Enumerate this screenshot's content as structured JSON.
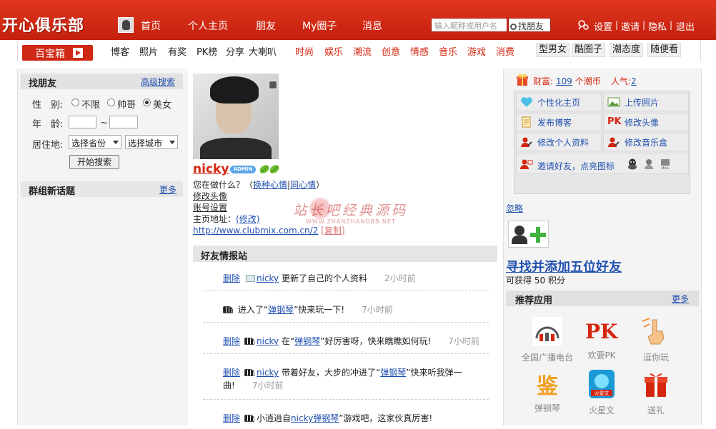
{
  "header": {
    "logo": "开心俱乐部",
    "nav": [
      "首页",
      "个人主页",
      "朋友",
      "My圈子",
      "消息"
    ],
    "search_placeholder": "输入昵称或用户名",
    "find_friend_btn": "找朋友",
    "links": [
      "设置",
      "邀请",
      "隐私",
      "退出"
    ]
  },
  "subnav": {
    "baobox": "百宝箱",
    "group1": [
      "博客",
      "照片",
      "有奖",
      "PK榜",
      "分享",
      "大喇叭"
    ],
    "group2": [
      "时尚",
      "娱乐",
      "潮流",
      "创意",
      "情感",
      "音乐",
      "游戏",
      "消费"
    ],
    "group3": [
      "型男女",
      "酷圈子",
      "潮态度",
      "随便看"
    ]
  },
  "left": {
    "find_title": "找朋友",
    "advanced": "高级搜索",
    "gender_label": "性　别:",
    "gender_options": [
      "不限",
      "帅哥",
      "美女"
    ],
    "gender_selected": 2,
    "age_label": "年　龄:",
    "age_sep": "~",
    "location_label": "居住地:",
    "province": "选择省份",
    "city": "选择城市",
    "search_btn": "开始搜索",
    "topics_title": "群组新话题",
    "more": "更多"
  },
  "profile": {
    "name": "nicky",
    "admin": "ADMIN",
    "doing": "您在做什么？",
    "mood_paren_open": "（",
    "change_mood": "换种心情",
    "pipe": "|",
    "same_mood": "同心情",
    "mood_paren_close": "）",
    "edit_avatar": "修改头像",
    "account_settings": "账号设置",
    "homepage_label": "主页地址：",
    "edit": "(修改)",
    "url": "http://www.clubmix.com.cn/2",
    "copy": "[复制]"
  },
  "watermark": {
    "line1": "站长吧经典源码",
    "line2": "WWW.ZHANZHANGBB.NET"
  },
  "feed": {
    "title": "好友情报站",
    "delete_label": "删除",
    "items": [
      {
        "del": true,
        "user": "nicky",
        "pre": "",
        "text": "更新了自己的个人资料",
        "app": "",
        "post": "",
        "time": "2小时前"
      },
      {
        "del": false,
        "user": "",
        "pre": "进入了“",
        "text": "",
        "app": "弹钢琴",
        "post": "”快来玩一下!",
        "time": "7小时前"
      },
      {
        "del": true,
        "user": "nicky",
        "pre": "在“",
        "text": "",
        "app": "弹钢琴",
        "post": "”好厉害呀，快来瞧瞧如何玩!",
        "time": "7小时前"
      },
      {
        "del": true,
        "user": "nicky",
        "pre": "带着好友，大步的冲进了“",
        "text": "",
        "app": "弹钢琴",
        "post": "”快来听我弹一",
        "post2": "曲!",
        "time": "7小时前"
      },
      {
        "del": true,
        "user": "nicky",
        "pre": "小逍逍自",
        "text": "",
        "app": "弹钢琴",
        "post": "”游戏吧，这家伙真厉害!",
        "time": ""
      }
    ]
  },
  "right": {
    "wealth_label": "财富:",
    "wealth_value": "109",
    "wealth_unit": "个潮币",
    "popularity_label": "人气:",
    "popularity_value": "2",
    "quick": [
      "个性化主页",
      "上传照片",
      "发布博客",
      "修改头像",
      "修改个人资料",
      "修改音乐盒"
    ],
    "invite": "邀请好友，点亮图标",
    "ignore": "忽略",
    "find_five": "寻找并添加五位好友",
    "earn_pre": "可获得",
    "earn_value": "50",
    "earn_unit": "积分",
    "apps_title": "推荐应用",
    "apps_more": "更多",
    "apps": [
      "全国广播电台",
      "欢要PK",
      "逗你玩",
      "弹钢琴",
      "火星文",
      "送礼"
    ]
  },
  "colors": {
    "brand_red": "#d4260f",
    "link_blue": "#2050b0"
  }
}
